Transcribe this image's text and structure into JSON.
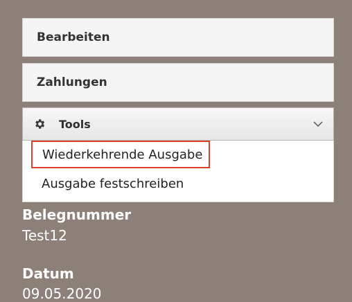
{
  "buttons": {
    "edit_label": "Bearbeiten",
    "payments_label": "Zahlungen"
  },
  "tools": {
    "label": "Tools",
    "icon": "gear-icon",
    "chevron": "chevron-down-icon",
    "menu_items": [
      {
        "label": "Wiederkehrende Ausgabe",
        "highlighted": true
      },
      {
        "label": "Ausgabe festschreiben",
        "highlighted": false
      }
    ]
  },
  "fields": {
    "belegnummer": {
      "label": "Belegnummer",
      "value": "Test12"
    },
    "datum": {
      "label": "Datum",
      "value": "09.05.2020"
    }
  },
  "colors": {
    "background": "#8c8079",
    "highlight_border": "#d9412b"
  }
}
